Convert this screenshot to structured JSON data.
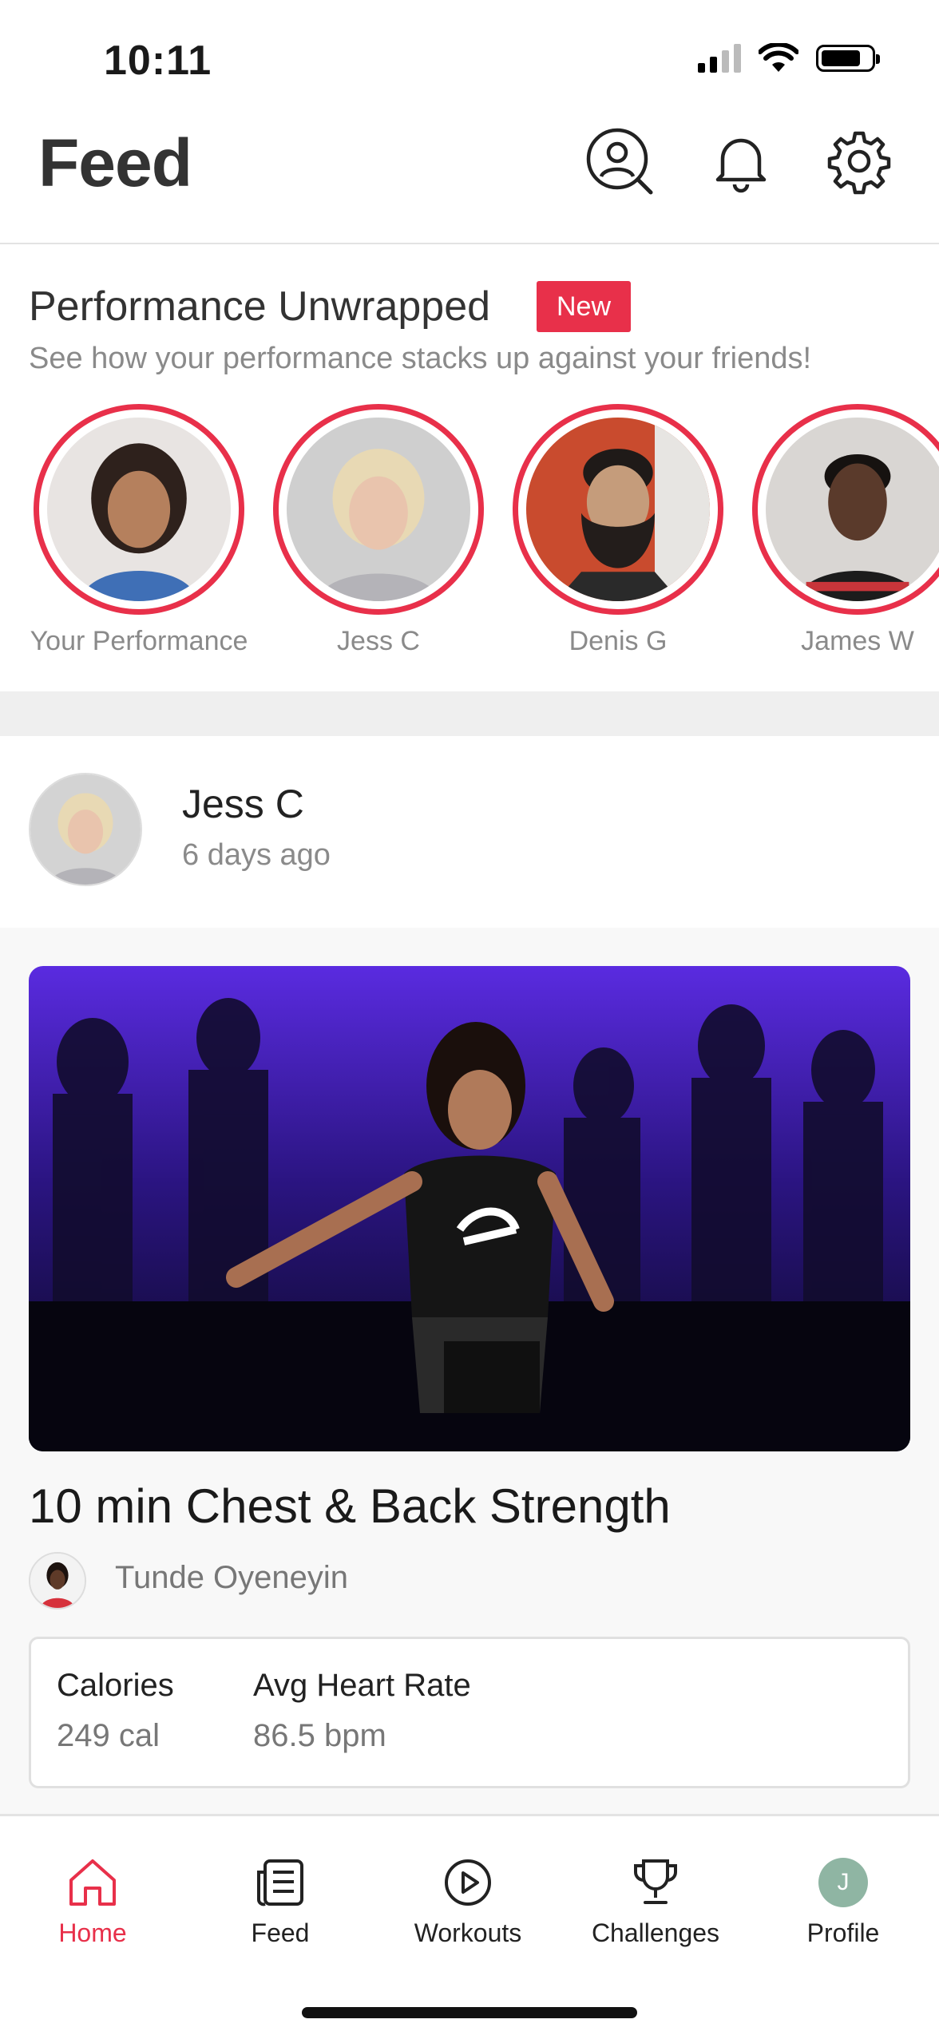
{
  "status_bar": {
    "time": "10:11"
  },
  "header": {
    "title": "Feed",
    "icons": [
      "find-friends-icon",
      "bell-icon",
      "gear-icon"
    ]
  },
  "performance_unwrapped": {
    "title": "Performance Unwrapped",
    "badge": "New",
    "subtitle": "See how your performance stacks up against your friends!",
    "stories": [
      {
        "name": "Your Performance"
      },
      {
        "name": "Jess C"
      },
      {
        "name": "Denis G"
      },
      {
        "name": "James W"
      }
    ],
    "accent_color": "#e8304a"
  },
  "post": {
    "author": "Jess C",
    "time_ago": "6 days ago",
    "workout_title": "10 min Chest & Back Strength",
    "instructor": "Tunde Oyeneyin",
    "stats": [
      {
        "label": "Calories",
        "value": "249 cal"
      },
      {
        "label": "Avg Heart Rate",
        "value": "86.5 bpm"
      }
    ]
  },
  "tab_bar": {
    "active": "Home",
    "tabs": [
      {
        "label": "Home",
        "icon": "home-icon"
      },
      {
        "label": "Feed",
        "icon": "feed-icon"
      },
      {
        "label": "Workouts",
        "icon": "play-circle-icon"
      },
      {
        "label": "Challenges",
        "icon": "trophy-icon"
      },
      {
        "label": "Profile",
        "icon": "profile-avatar",
        "initial": "J"
      }
    ]
  }
}
